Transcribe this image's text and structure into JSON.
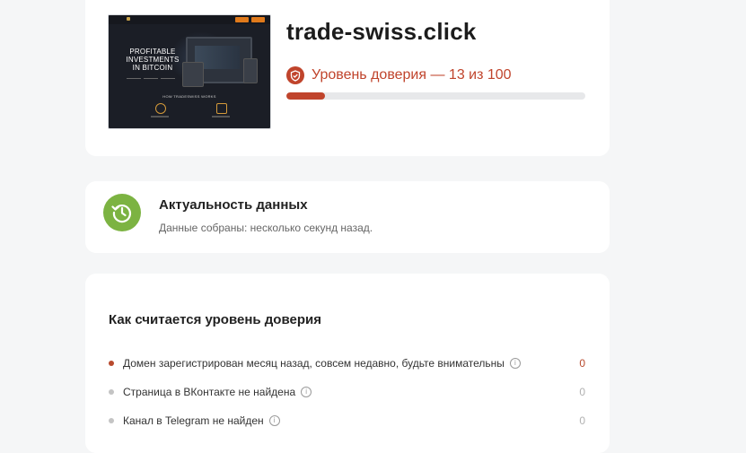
{
  "site": {
    "domain": "trade-swiss.click",
    "trust_text": "Уровень доверия — 13 из 100",
    "trust_score": 13,
    "trust_max": 100,
    "accent_color": "#c0442c",
    "thumbnail": {
      "hero_line1": "PROFITABLE",
      "hero_line2": "INVESTMENTS",
      "hero_line3": "IN BITCOIN",
      "section_label": "HOW TRADESWISS WORKS"
    }
  },
  "freshness": {
    "title": "Актуальность данных",
    "subtitle": "Данные собраны: несколько секунд назад.",
    "icon": "history-icon",
    "icon_color": "#7cb342"
  },
  "calculation": {
    "title": "Как считается уровень доверия",
    "factors": [
      {
        "text": "Домен зарегистрирован месяц назад, совсем недавно, будьте внимательны",
        "score": "0",
        "status": "negative",
        "dot_color": "#b84a2e",
        "score_color": "#b84a2e"
      },
      {
        "text": "Страница в ВКонтакте не найдена",
        "score": "0",
        "status": "neutral",
        "dot_color": "#c4c4c4",
        "score_color": "#b0b0b0"
      },
      {
        "text": "Канал в Telegram не найден",
        "score": "0",
        "status": "neutral",
        "dot_color": "#c4c4c4",
        "score_color": "#b0b0b0"
      }
    ]
  }
}
